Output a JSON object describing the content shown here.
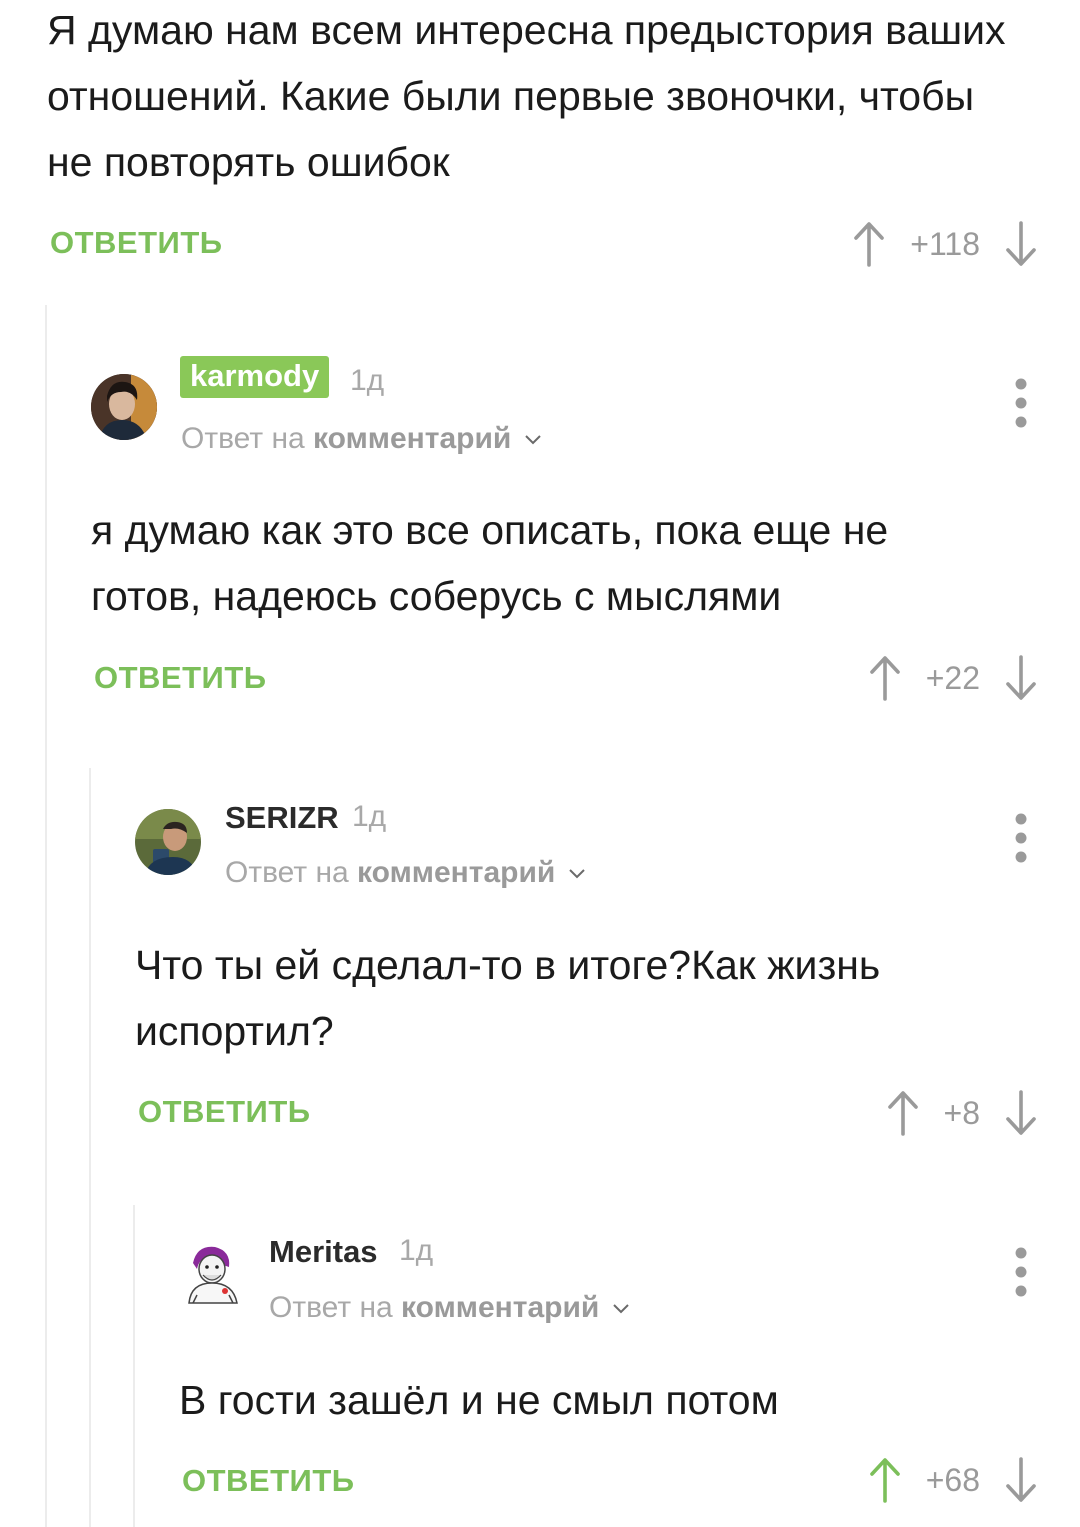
{
  "root_comment": {
    "text": "Я думаю нам всем интересна предыстория ваших отношений. Какие были первые звоночки, чтобы не повторять ошибок",
    "reply_label": "ОТВЕТИТЬ",
    "rating": "+118"
  },
  "comments": [
    {
      "username": "karmody",
      "time": "1д",
      "reply_prefix": "Ответ на",
      "reply_target": "комментарий",
      "text": "я думаю как это все описать, пока еще не готов, надеюсь соберусь с мыслями",
      "reply_label": "ОТВЕТИТЬ",
      "rating": "+22"
    },
    {
      "username": "SERIZR",
      "time": "1д",
      "reply_prefix": "Ответ на",
      "reply_target": "комментарий",
      "text": "Что ты ей сделал-то в итоге?Как жизнь испортил?",
      "reply_label": "ОТВЕТИТЬ",
      "rating": "+8"
    },
    {
      "username": "Meritas",
      "time": "1д",
      "reply_prefix": "Ответ на",
      "reply_target": "комментарий",
      "text": "В гости зашёл и не смыл потом",
      "reply_label": "ОТВЕТИТЬ",
      "rating": "+68"
    }
  ],
  "icons": {
    "upvote": "arrow-up-icon",
    "downvote": "arrow-down-icon",
    "menu": "more-vertical-icon",
    "expand": "chevron-down-icon"
  },
  "colors": {
    "accent": "#7cbf5a",
    "badge": "#8ac858",
    "muted": "#a8a8a8",
    "text": "#1b1b1b",
    "thread_line": "#ececec"
  }
}
